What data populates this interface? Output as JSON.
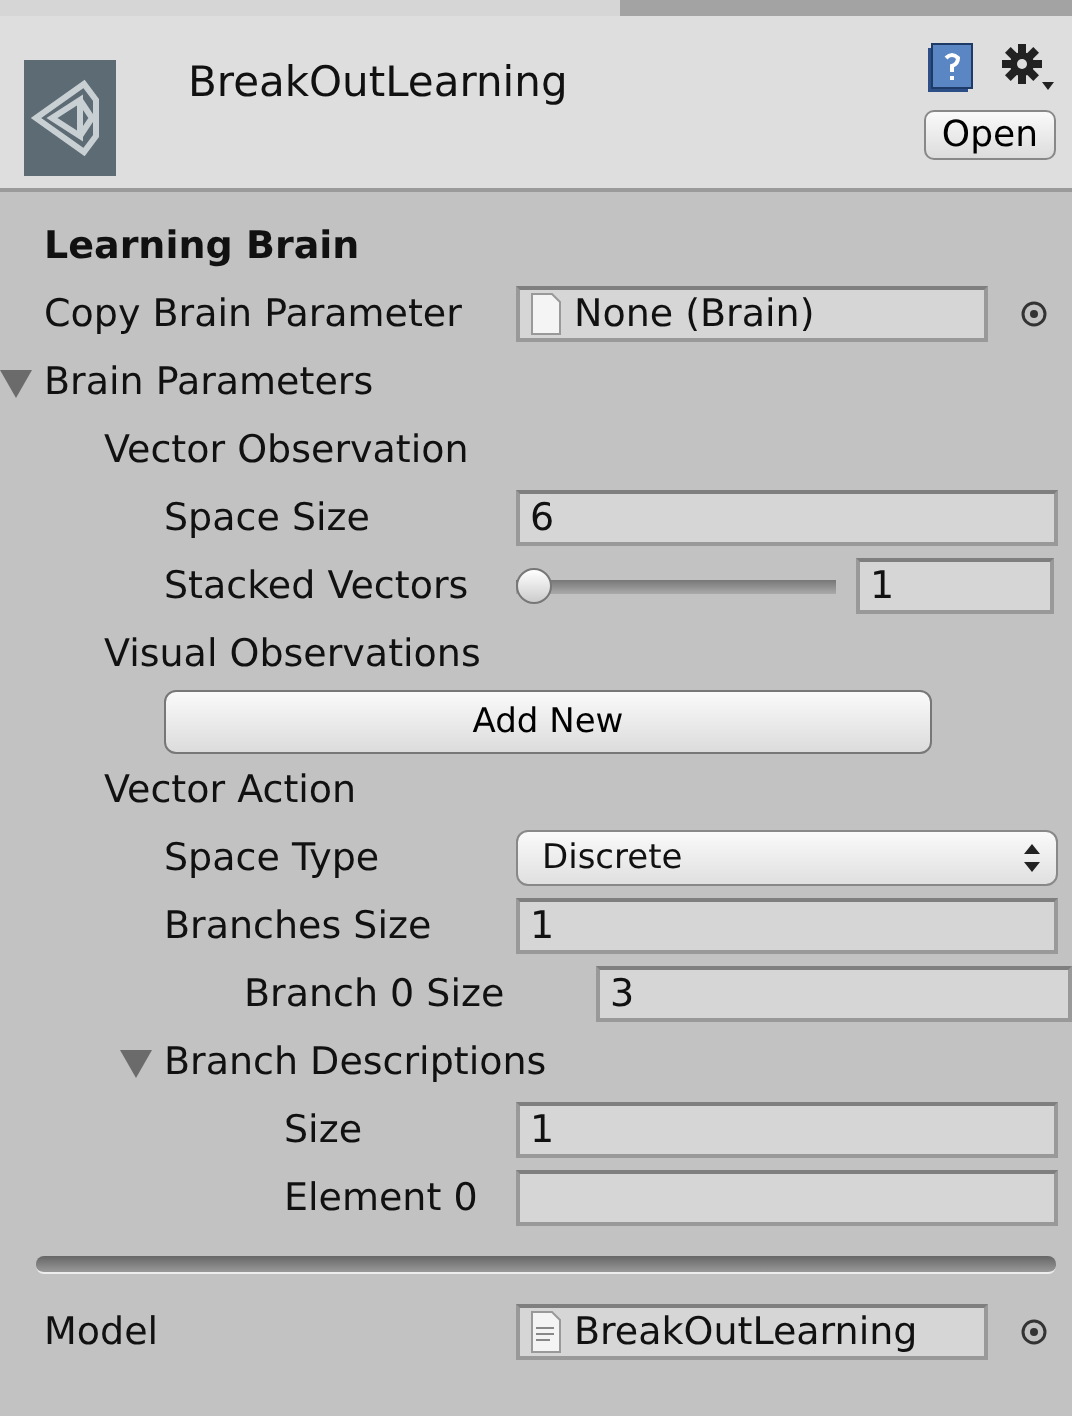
{
  "header": {
    "title": "BreakOutLearning",
    "open_button": "Open"
  },
  "section_title": "Learning Brain",
  "fields": [
    {
      "kind": "object",
      "label": "Copy Brain Parameter",
      "value": "None (Brain)"
    },
    {
      "kind": "foldout",
      "label": "Brain Parameters",
      "expanded": true,
      "children": [
        {
          "kind": "group",
          "label": "Vector Observation",
          "children": [
            {
              "kind": "field",
              "label": "Space Size",
              "value": "6"
            },
            {
              "kind": "slider",
              "label": "Stacked Vectors",
              "level": 0,
              "value": "1"
            }
          ]
        },
        {
          "kind": "group",
          "label": "Visual Observations",
          "children": [
            {
              "kind": "button",
              "label": "Add New"
            }
          ]
        },
        {
          "kind": "group",
          "label": "Vector Action",
          "children": [
            {
              "kind": "dropdown",
              "label": "Space Type",
              "value": "Discrete"
            },
            {
              "kind": "field",
              "label": "Branches Size",
              "value": "1",
              "children": [
                {
                  "kind": "field",
                  "label": "Branch 0 Size",
                  "value": "3"
                }
              ]
            },
            {
              "kind": "foldout",
              "label": "Branch Descriptions",
              "expanded": true,
              "children": [
                {
                  "kind": "field",
                  "label": "Size",
                  "value": "1"
                },
                {
                  "kind": "field",
                  "label": "Element 0"
                }
              ]
            }
          ]
        }
      ]
    }
  ],
  "model": {
    "label": "Model",
    "value": "BreakOutLearning"
  }
}
